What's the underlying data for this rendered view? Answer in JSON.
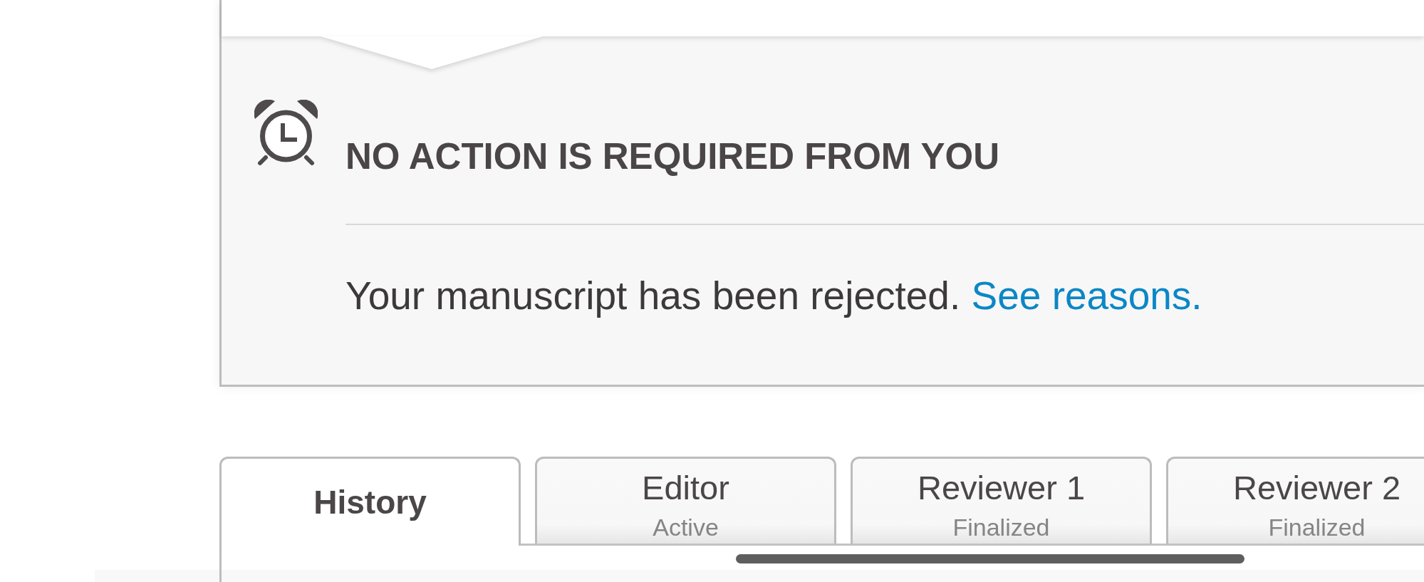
{
  "notice": {
    "heading": "NO ACTION IS REQUIRED FROM YOU",
    "message": "Your manuscript has been rejected.",
    "link": "See reasons."
  },
  "tabs": [
    {
      "label": "History",
      "selected": true
    },
    {
      "label": "Editor",
      "status": "Active",
      "selected": false
    },
    {
      "label": "Reviewer 1",
      "status": "Finalized",
      "selected": false
    },
    {
      "label": "Reviewer 2",
      "status": "Finalized",
      "selected": false
    }
  ]
}
